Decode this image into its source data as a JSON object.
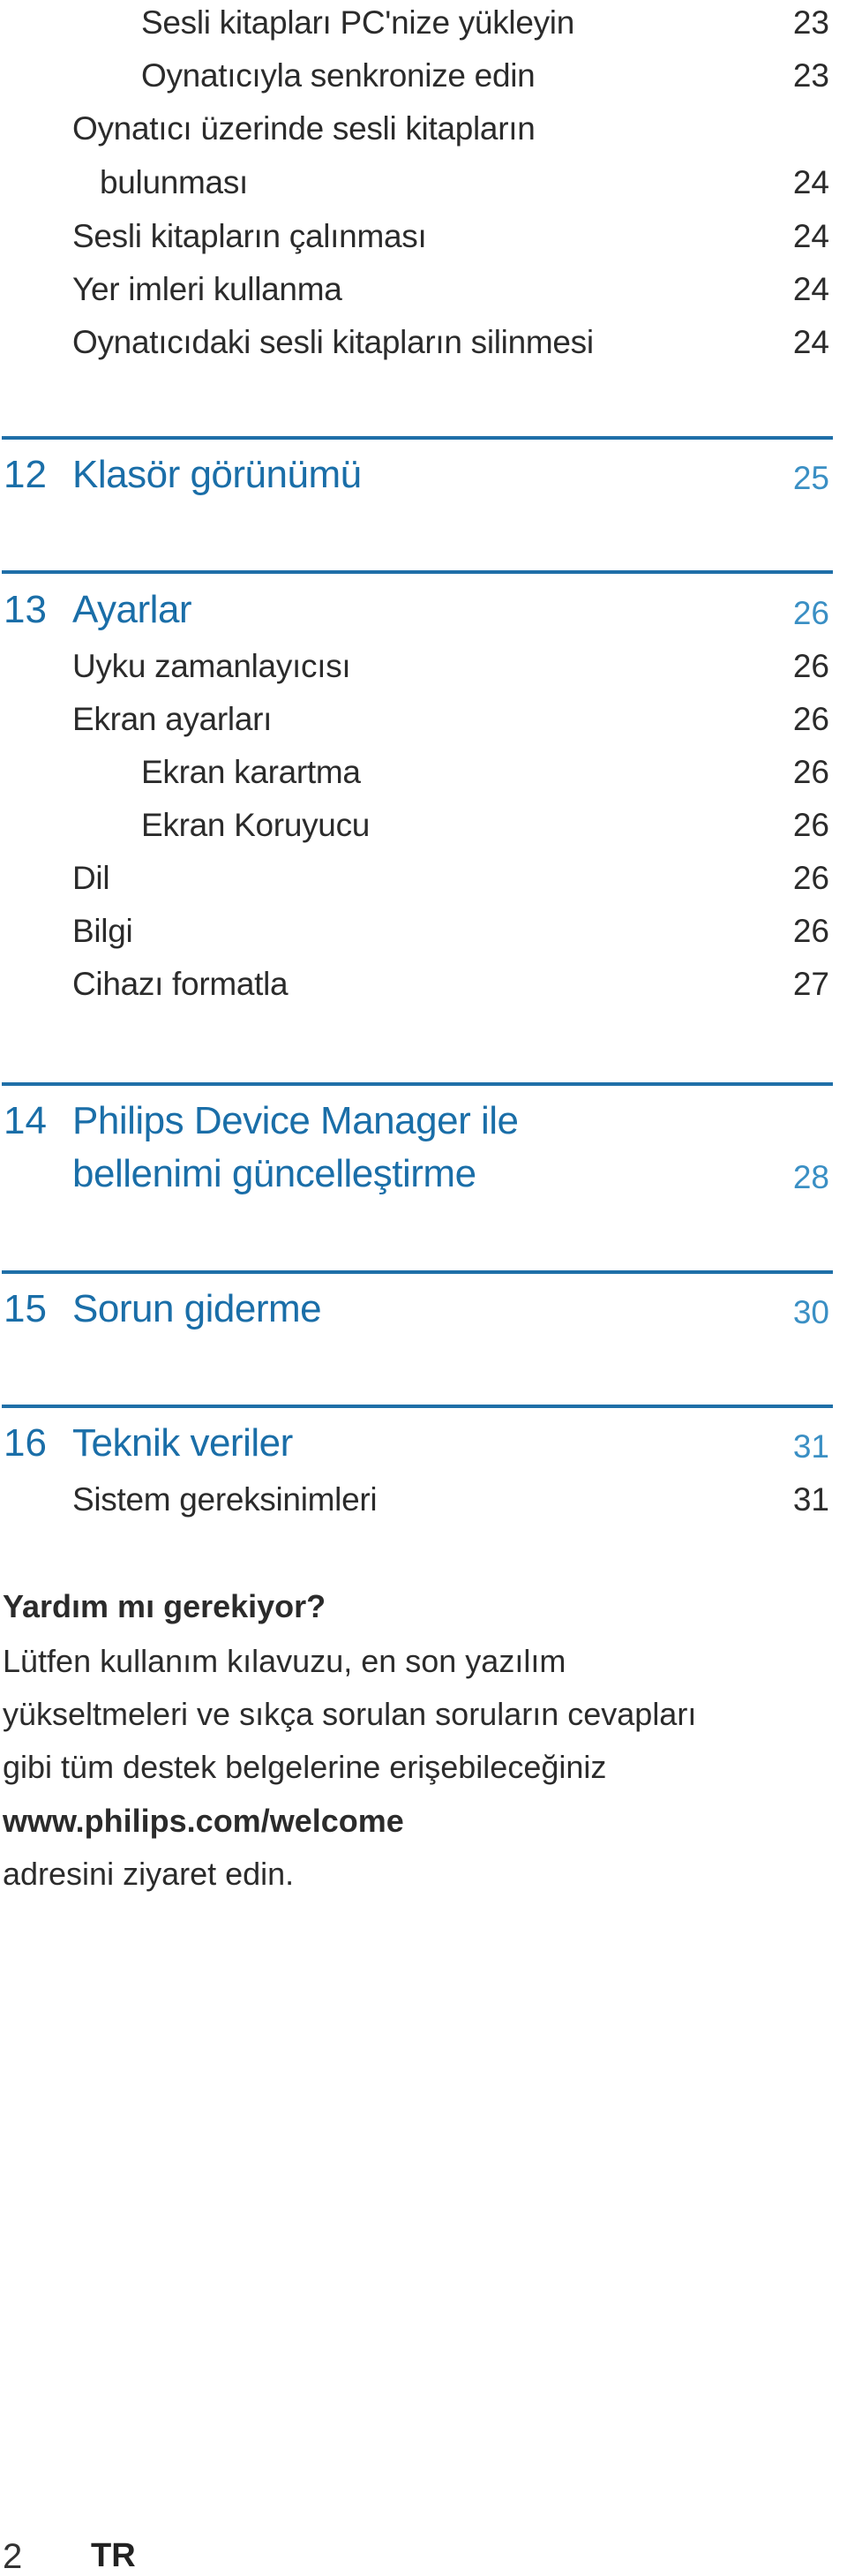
{
  "toc_top": [
    {
      "title": "Sesli kitapları PC'nize yükleyin",
      "page": "23"
    },
    {
      "title": "Oynatıcıyla senkronize edin",
      "page": "23"
    },
    {
      "title": "Oynatıcı üzerinde sesli kitapların",
      "title_cont": "bulunması",
      "page": "24"
    },
    {
      "title": "Sesli kitapların çalınması",
      "page": "24"
    },
    {
      "title": "Yer imleri kullanma",
      "page": "24"
    },
    {
      "title": "Oynatıcıdaki sesli kitapların silinmesi",
      "page": "24"
    }
  ],
  "sections": [
    {
      "number": "12",
      "title": "Klasör görünümü",
      "page": "25",
      "items": []
    },
    {
      "number": "13",
      "title": "Ayarlar",
      "page": "26",
      "items": [
        {
          "title": "Uyku zamanlayıcısı",
          "page": "26"
        },
        {
          "title": "Ekran ayarları",
          "page": "26"
        },
        {
          "title": "Ekran karartma",
          "page": "26"
        },
        {
          "title": "Ekran Koruyucu",
          "page": "26"
        },
        {
          "title": "Dil",
          "page": "26"
        },
        {
          "title": "Bilgi",
          "page": "26"
        },
        {
          "title": "Cihazı formatla",
          "page": "27"
        }
      ]
    },
    {
      "number": "14",
      "title": "Philips Device Manager ile",
      "title_cont": "bellenimi güncelleştirme",
      "page": "28",
      "items": []
    },
    {
      "number": "15",
      "title": "Sorun giderme",
      "page": "30",
      "items": []
    },
    {
      "number": "16",
      "title": "Teknik veriler",
      "page": "31",
      "items": [
        {
          "title": "Sistem gereksinimleri",
          "page": "31"
        }
      ]
    }
  ],
  "help": {
    "heading": "Yardım mı gerekiyor?",
    "lines": [
      "Lütfen kullanım kılavuzu, en son yazılım",
      "yükseltmeleri ve sıkça sorulan soruların cevapları",
      "gibi tüm destek belgelerine erişebileceğiniz"
    ],
    "link": "www.philips.com/welcome",
    "closing": "adresini ziyaret edin."
  },
  "footer": {
    "page_number": "2",
    "language": "TR"
  },
  "colors": {
    "accent": "#1a6ea8",
    "accent_light": "#3a8fc4",
    "text": "#2b2b2b"
  }
}
